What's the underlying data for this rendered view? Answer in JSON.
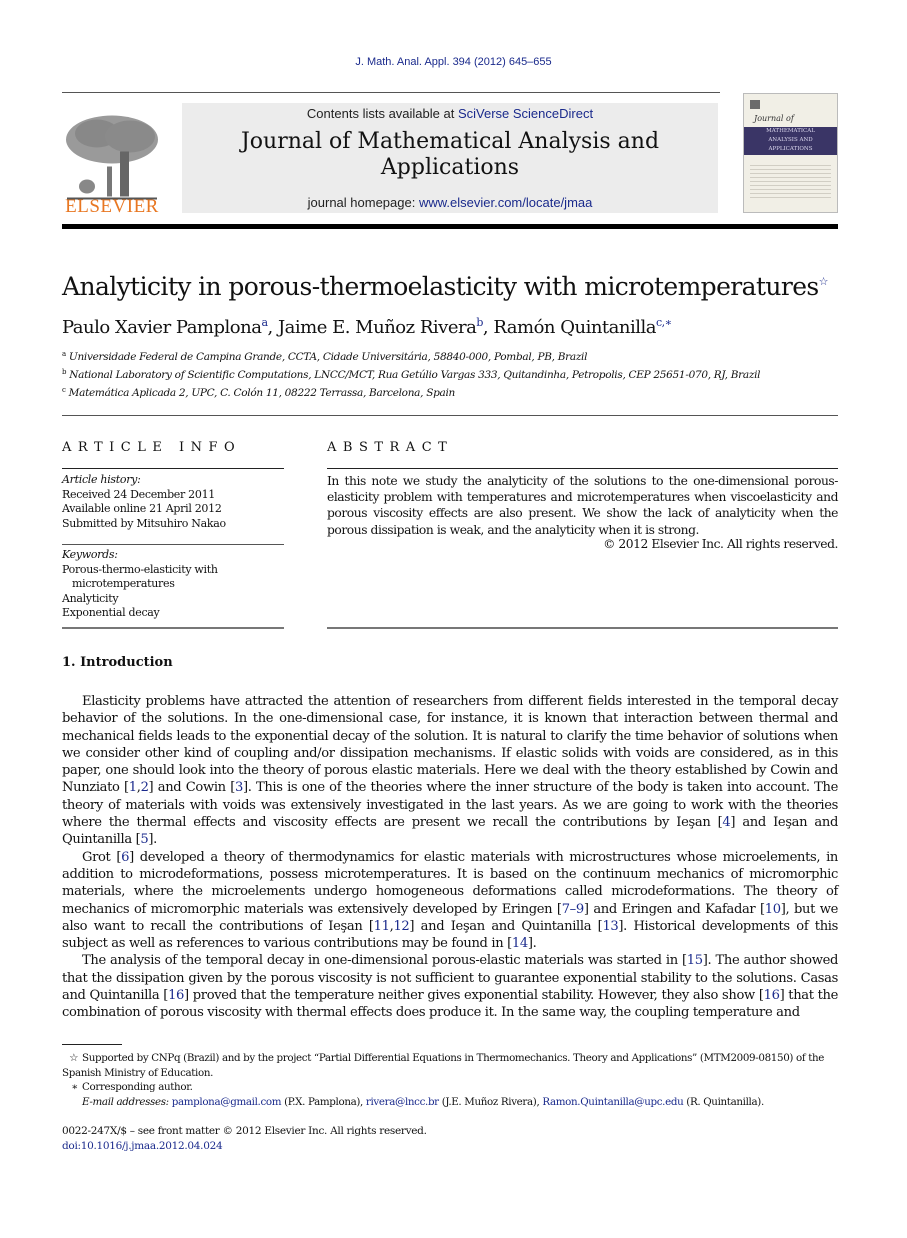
{
  "citation": "J. Math. Anal. Appl. 394 (2012) 645–655",
  "header": {
    "publisher_logo_text": "ELSEVIER",
    "contents_prefix": "Contents lists available at ",
    "contents_link": "SciVerse ScienceDirect",
    "journal_title": "Journal of Mathematical Analysis and Applications",
    "homepage_prefix": "journal homepage: ",
    "homepage_link": "www.elsevier.com/locate/jmaa",
    "cover": {
      "script_title": "Journal of",
      "lines": [
        "MATHEMATICAL",
        "ANALYSIS AND",
        "APPLICATIONS"
      ]
    }
  },
  "article": {
    "title": "Analyticity in porous-thermoelasticity with microtemperatures",
    "title_mark": "☆",
    "authors": [
      {
        "name": "Paulo Xavier Pamplona",
        "mark": "a"
      },
      {
        "name": "Jaime E. Muñoz Rivera",
        "mark": "b"
      },
      {
        "name": "Ramón Quintanilla",
        "mark": "c,∗"
      }
    ],
    "affiliations": [
      {
        "mark": "a",
        "text": "Universidade Federal de Campina Grande, CCTA, Cidade Universitária, 58840-000, Pombal, PB, Brazil"
      },
      {
        "mark": "b",
        "text": "National Laboratory of Scientific Computations, LNCC/MCT, Rua Getúlio Vargas 333, Quitandinha, Petropolis, CEP 25651-070, RJ, Brazil"
      },
      {
        "mark": "c",
        "text": "Matemática Aplicada 2, UPC, C. Colón 11, 08222 Terrassa, Barcelona, Spain"
      }
    ]
  },
  "article_info": {
    "heading": "ARTICLE INFO",
    "history_label": "Article history:",
    "history": [
      "Received 24 December 2011",
      "Available online 21 April 2012",
      "Submitted by Mitsuhiro Nakao"
    ],
    "keywords_label": "Keywords:",
    "keywords": [
      {
        "text": "Porous-thermo-elasticity with",
        "indent": false
      },
      {
        "text": "microtemperatures",
        "indent": true
      },
      {
        "text": "Analyticity",
        "indent": false
      },
      {
        "text": "Exponential decay",
        "indent": false
      }
    ]
  },
  "abstract": {
    "heading": "ABSTRACT",
    "text": "In this note we study the analyticity of the solutions to the one-dimensional porous-elasticity problem with temperatures and microtemperatures when viscoelasticity and porous viscosity effects are also present. We show the lack of analyticity when the porous dissipation is weak, and the analyticity when it is strong.",
    "copyright": "© 2012 Elsevier Inc. All rights reserved."
  },
  "section": {
    "heading": "1.  Introduction",
    "paragraphs": [
      [
        {
          "t": "Elasticity problems have attracted the attention of researchers from different fields interested in the temporal decay behavior of the solutions. In the one-dimensional case, for instance, it is known that interaction between thermal and mechanical fields leads to the exponential decay of the solution. It is natural to clarify the time behavior of solutions when we consider other kind of coupling and/or dissipation mechanisms. If elastic solids with voids are considered, as in this paper, one should look into the theory of porous elastic materials. Here we deal with the theory established by Cowin and Nunziato ["
        },
        {
          "t": "1",
          "ref": true
        },
        {
          "t": ","
        },
        {
          "t": "2",
          "ref": true
        },
        {
          "t": "] and Cowin ["
        },
        {
          "t": "3",
          "ref": true
        },
        {
          "t": "]. This is one of the theories where the inner structure of the body is taken into account. The theory of materials with voids was extensively investigated in the last years. As we are going to work with the theories where the thermal effects and viscosity effects are present we recall the contributions by Ieşan ["
        },
        {
          "t": "4",
          "ref": true
        },
        {
          "t": "] and Ieşan and Quintanilla ["
        },
        {
          "t": "5",
          "ref": true
        },
        {
          "t": "]."
        }
      ],
      [
        {
          "t": "Grot ["
        },
        {
          "t": "6",
          "ref": true
        },
        {
          "t": "] developed a theory of thermodynamics for elastic materials with microstructures whose microelements, in addition to microdeformations, possess microtemperatures. It is based on the continuum mechanics of micromorphic materials, where the microelements undergo homogeneous deformations called microdeformations. The theory of mechanics of micromorphic materials was extensively developed by Eringen ["
        },
        {
          "t": "7–9",
          "ref": true
        },
        {
          "t": "] and Eringen and Kafadar ["
        },
        {
          "t": "10",
          "ref": true
        },
        {
          "t": "], but we also want to recall the contributions of Ieşan ["
        },
        {
          "t": "11",
          "ref": true
        },
        {
          "t": ","
        },
        {
          "t": "12",
          "ref": true
        },
        {
          "t": "] and Ieşan and Quintanilla ["
        },
        {
          "t": "13",
          "ref": true
        },
        {
          "t": "]. Historical developments of this subject as well as references to various contributions may be found in ["
        },
        {
          "t": "14",
          "ref": true
        },
        {
          "t": "]."
        }
      ],
      [
        {
          "t": "The analysis of the temporal decay in one-dimensional porous-elastic materials was started in ["
        },
        {
          "t": "15",
          "ref": true
        },
        {
          "t": "]. The author showed that the dissipation given by the porous viscosity is not sufficient to guarantee exponential stability to the solutions. Casas and Quintanilla ["
        },
        {
          "t": "16",
          "ref": true
        },
        {
          "t": "] proved that the temperature neither gives exponential stability. However, they also show ["
        },
        {
          "t": "16",
          "ref": true
        },
        {
          "t": "] that the combination of porous viscosity with thermal effects does produce it. In the same way, the coupling temperature and"
        }
      ]
    ]
  },
  "footnotes": {
    "star_mark": "☆",
    "star_text": "Supported by CNPq (Brazil) and by the project “Partial Differential Equations in Thermomechanics. Theory and Applications” (MTM2009-08150) of the Spanish Ministry of Education.",
    "corr_mark": "∗",
    "corr_text": "Corresponding author.",
    "email_label": "E-mail addresses:",
    "emails": [
      {
        "address": "pamplona@gmail.com",
        "who": " (P.X. Pamplona), "
      },
      {
        "address": "rivera@lncc.br",
        "who": " (J.E. Muñoz Rivera), "
      },
      {
        "address": "Ramon.Quintanilla@upc.edu",
        "who": " (R. Quintanilla)."
      }
    ]
  },
  "bottom": {
    "front_matter": "0022-247X/$ – see front matter © 2012 Elsevier Inc. All rights reserved.",
    "doi": "doi:10.1016/j.jmaa.2012.04.024"
  },
  "colors": {
    "link": "#1a2a8c",
    "elsevier_orange": "#e87722",
    "cover_band": "#3a3566",
    "header_box": "#ececec"
  }
}
